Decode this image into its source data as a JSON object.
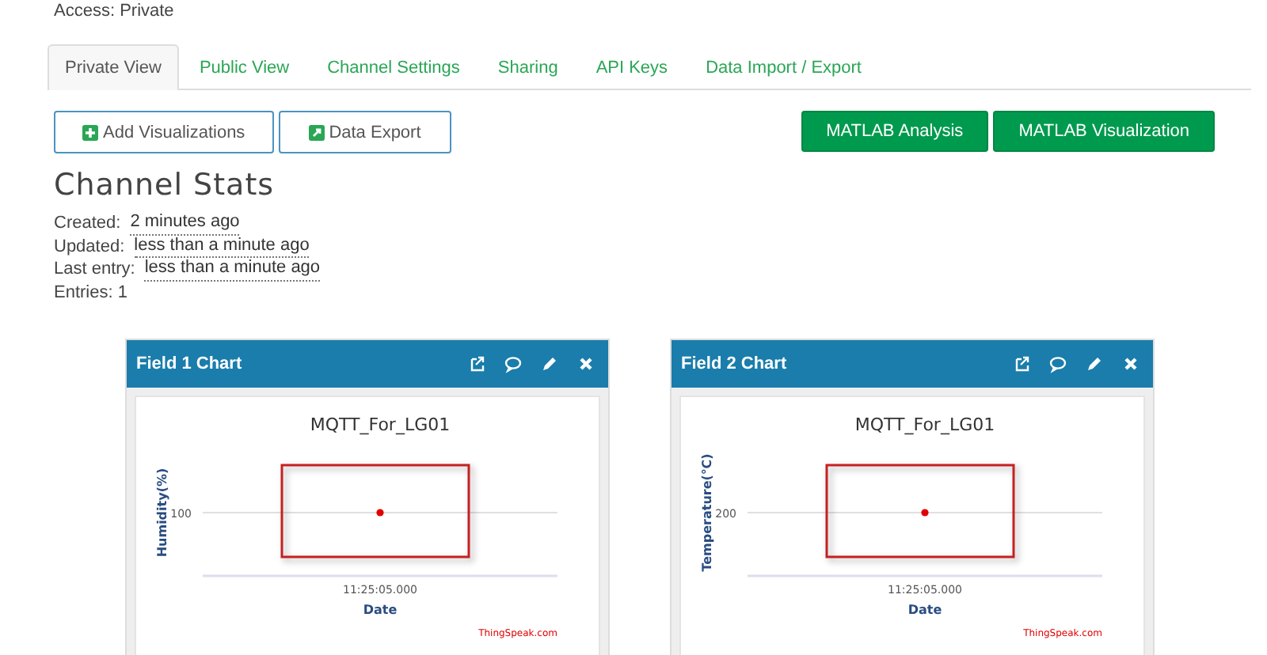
{
  "access": "Access: Private",
  "tabs": [
    {
      "label": "Private View",
      "selected": true
    },
    {
      "label": "Public View",
      "selected": false
    },
    {
      "label": "Channel Settings",
      "selected": false
    },
    {
      "label": "Sharing",
      "selected": false
    },
    {
      "label": "API Keys",
      "selected": false
    },
    {
      "label": "Data Import / Export",
      "selected": false
    }
  ],
  "left_buttons": [
    {
      "label": "Add Visualizations",
      "kind": "add"
    },
    {
      "label": "Data Export",
      "kind": "export"
    }
  ],
  "right_buttons": [
    {
      "label": "MATLAB Analysis"
    },
    {
      "label": "MATLAB Visualization"
    }
  ],
  "stats": {
    "title": "Channel Stats",
    "items": [
      {
        "label": "Created:",
        "value": "2 minutes ago"
      },
      {
        "label": "Updated:",
        "value": "less than a minute ago"
      },
      {
        "label": "Last entry:",
        "value": "less than a minute ago"
      },
      {
        "label": "Entries: 1"
      }
    ]
  },
  "charts": [
    {
      "title": "Field 1 Chart",
      "credit": "ThingSpeak.com",
      "plot": {
        "title": "MQTT_For_LG01",
        "xlabel": "Date",
        "ylabel": "Humidity(%)",
        "x_tick": "11:25:05.000",
        "y_tick": "100"
      }
    },
    {
      "title": "Field 2 Chart",
      "credit": "ThingSpeak.com",
      "plot": {
        "title": "MQTT_For_LG01",
        "xlabel": "Date",
        "ylabel": "Temperature(℃)",
        "x_tick": "11:25:05.000",
        "y_tick": "200"
      }
    }
  ]
}
